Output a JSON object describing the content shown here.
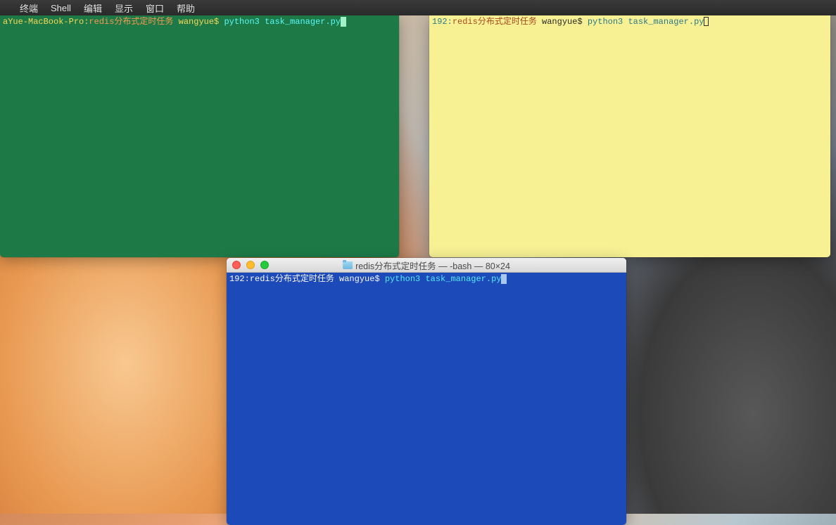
{
  "menubar": {
    "items": [
      "终端",
      "Shell",
      "编辑",
      "显示",
      "窗口",
      "帮助"
    ]
  },
  "terminals": {
    "green": {
      "host": "aYue-MacBook-Pro:",
      "path": "redis分布式定时任务",
      "user": " wangyue",
      "dollar": "$ ",
      "command": "python3 task_manager.py"
    },
    "yellow": {
      "host": "192:",
      "path": "redis分布式定时任务",
      "user": " wangyue",
      "dollar": "$ ",
      "command": "python3 task_manager.py"
    },
    "blue": {
      "title": "redis分布式定时任务 — -bash — 80×24",
      "host": "192:",
      "path": "redis分布式定时任务",
      "user": " wangyue",
      "dollar": "$ ",
      "command": "python3 task_manager.py"
    }
  }
}
